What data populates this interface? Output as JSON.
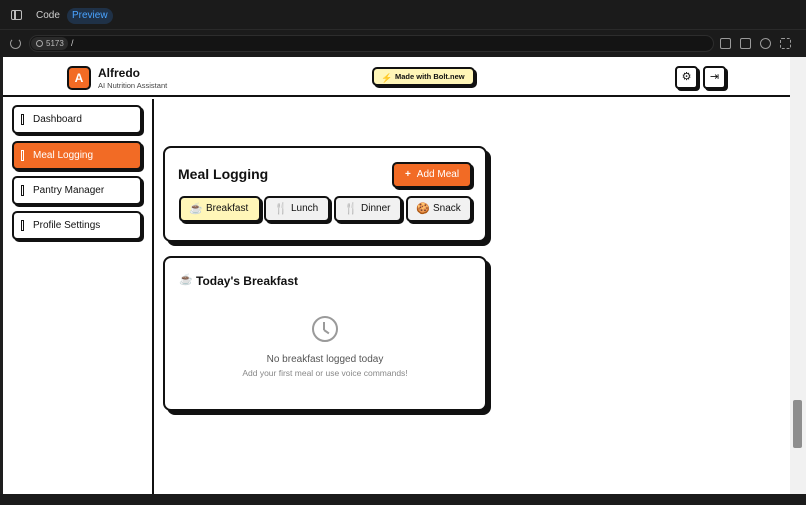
{
  "editor": {
    "code_label": "Code",
    "preview_label": "Preview",
    "port": "5173",
    "path": "/"
  },
  "header": {
    "logo_letter": "A",
    "brand": "Alfredo",
    "tagline": "AI Nutrition Assistant",
    "badge": "Made with Bolt.new"
  },
  "sidebar": {
    "items": [
      {
        "label": "Dashboard",
        "active": false
      },
      {
        "label": "Meal Logging",
        "active": true
      },
      {
        "label": "Pantry Manager",
        "active": false
      },
      {
        "label": "Profile Settings",
        "active": false
      }
    ]
  },
  "meal_logging": {
    "title": "Meal Logging",
    "add_button": "Add Meal",
    "meal_types": [
      {
        "label": "Breakfast",
        "icon": "coffee-icon",
        "active": true
      },
      {
        "label": "Lunch",
        "icon": "utensils-icon",
        "active": false
      },
      {
        "label": "Dinner",
        "icon": "utensils-icon",
        "active": false
      },
      {
        "label": "Snack",
        "icon": "cookie-icon",
        "active": false
      }
    ]
  },
  "today": {
    "title": "Today's Breakfast",
    "empty_title": "No breakfast logged today",
    "empty_hint": "Add your first meal or use voice commands!"
  },
  "colors": {
    "accent": "#f26b25",
    "highlight": "#fff6b8",
    "border": "#111111"
  }
}
